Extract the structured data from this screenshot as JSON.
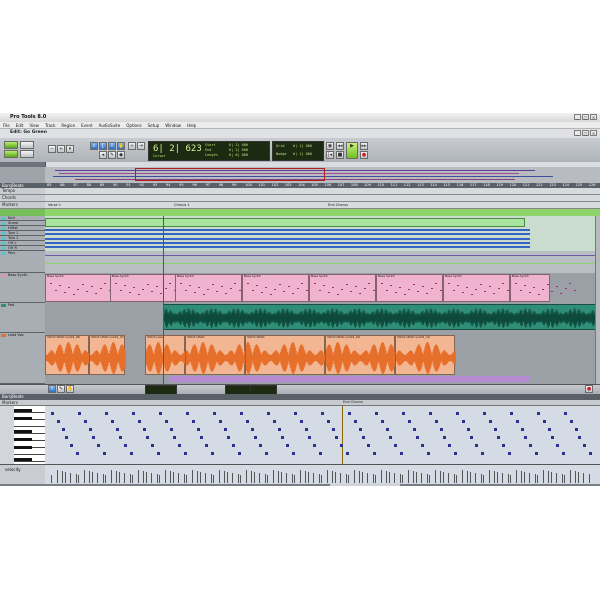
{
  "window": {
    "app_title": "Pro Tools 8.0",
    "edit_title": "Edit: Go Green"
  },
  "menu": [
    "File",
    "Edit",
    "View",
    "Track",
    "Region",
    "Event",
    "AudioSuite",
    "Options",
    "Setup",
    "Window",
    "Help"
  ],
  "toolbar": {
    "counter_main": "6| 2| 623",
    "counter_label": "Cursor",
    "start_label": "Start",
    "end_label": "End",
    "length_label": "Length",
    "start_value": "6| 2| 000",
    "end_value": "6| 2| 000",
    "length_value": "0| 0| 000",
    "grid_label": "Grid",
    "nudge_label": "Nudge",
    "grid_value": "0| 1| 000",
    "nudge_value": "0| 1| 000"
  },
  "rulers": {
    "bars_label": "Bars|Beats",
    "rows": [
      "Tempo",
      "Chords",
      "Markers"
    ],
    "bar_numbers": [
      "85",
      "86",
      "87",
      "88",
      "89",
      "90",
      "91",
      "92",
      "93",
      "94",
      "95",
      "96",
      "97",
      "98",
      "99",
      "100",
      "101",
      "102",
      "103",
      "104",
      "105",
      "106",
      "107",
      "108",
      "109",
      "110",
      "111",
      "112",
      "113",
      "114",
      "115",
      "116",
      "117",
      "118",
      "119",
      "120",
      "121",
      "122",
      "123",
      "124",
      "125",
      "126"
    ],
    "markers": [
      {
        "text": "Verse 1"
      },
      {
        "text": "Chorus 1"
      },
      {
        "text": "End Chorus"
      }
    ]
  },
  "tracks": [
    {
      "name": "Kick",
      "color": "#5bc4c9"
    },
    {
      "name": "Snare",
      "color": "#5bc4c9"
    },
    {
      "name": "HiHat",
      "color": "#5bc4c9"
    },
    {
      "name": "Tom 1",
      "color": "#5bc4c9"
    },
    {
      "name": "Tom 2",
      "color": "#5bc4c9"
    },
    {
      "name": "OH L",
      "color": "#5bc4c9"
    },
    {
      "name": "OH R",
      "color": "#5bc4c9"
    },
    {
      "name": "Perc",
      "color": "#5bc4c9"
    },
    {
      "name": "Bass Synth",
      "color": "#e58fb4"
    },
    {
      "name": "Pad",
      "color": "#2f8e77"
    },
    {
      "name": "Lead Vox",
      "color": "#e66f2c"
    }
  ],
  "clips": {
    "bass": [
      "Bass Synth",
      "Bass Synth",
      "Bass Synth",
      "Bass Synth",
      "Bass Synth",
      "Bass Synth",
      "Bass Synth",
      "Bass Synth"
    ],
    "vox": [
      "VOCX LEAD vox01_06",
      "VOCX LEAD vox01_07",
      "VOCX Lead",
      "VOCX LEAD",
      "VOCX LEAD",
      "VOCX LEAD vox01_09",
      "VOCX LEAD vox01_10"
    ]
  },
  "midi_editor": {
    "bars_label": "Bars|Beats",
    "markers_label": "Markers",
    "marker_text": "End Chorus",
    "velocity_label": "velocity"
  },
  "colors": {
    "drums": "#8ed88a",
    "drums_dark": "#2d5fb8",
    "bass": "#f0b3cf",
    "pad": "#2f8e77",
    "vox": "#e66f2c",
    "note": "#2b2f8f"
  }
}
